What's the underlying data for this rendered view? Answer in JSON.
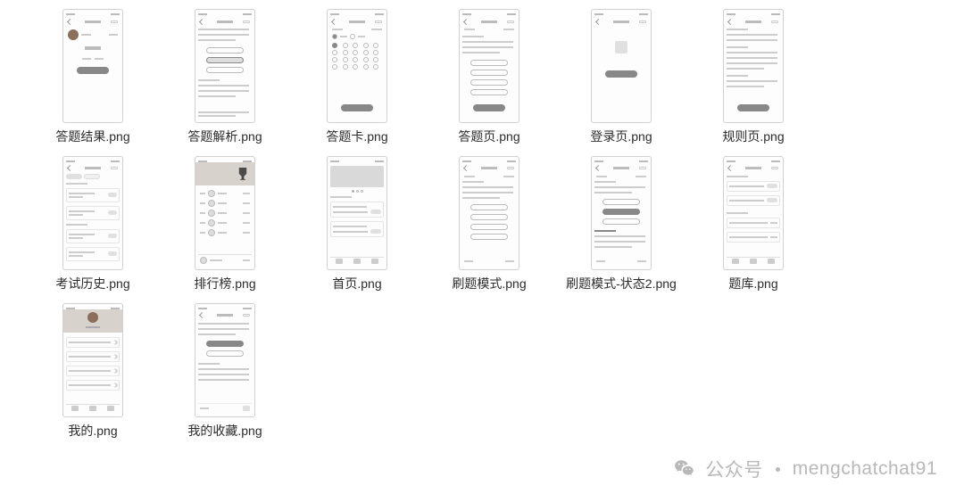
{
  "files": [
    {
      "label": "答题结果.png"
    },
    {
      "label": "答题解析.png"
    },
    {
      "label": "答题卡.png"
    },
    {
      "label": "答题页.png"
    },
    {
      "label": "登录页.png"
    },
    {
      "label": "规则页.png"
    },
    {
      "label": "考试历史.png"
    },
    {
      "label": "排行榜.png"
    },
    {
      "label": "首页.png"
    },
    {
      "label": "刷题模式.png"
    },
    {
      "label": "刷题模式-状态2.png"
    },
    {
      "label": "题库.png"
    },
    {
      "label": "我的.png"
    },
    {
      "label": "我的收藏.png"
    }
  ],
  "watermark": {
    "prefix": "公众号",
    "handle": "mengchatchat91"
  }
}
